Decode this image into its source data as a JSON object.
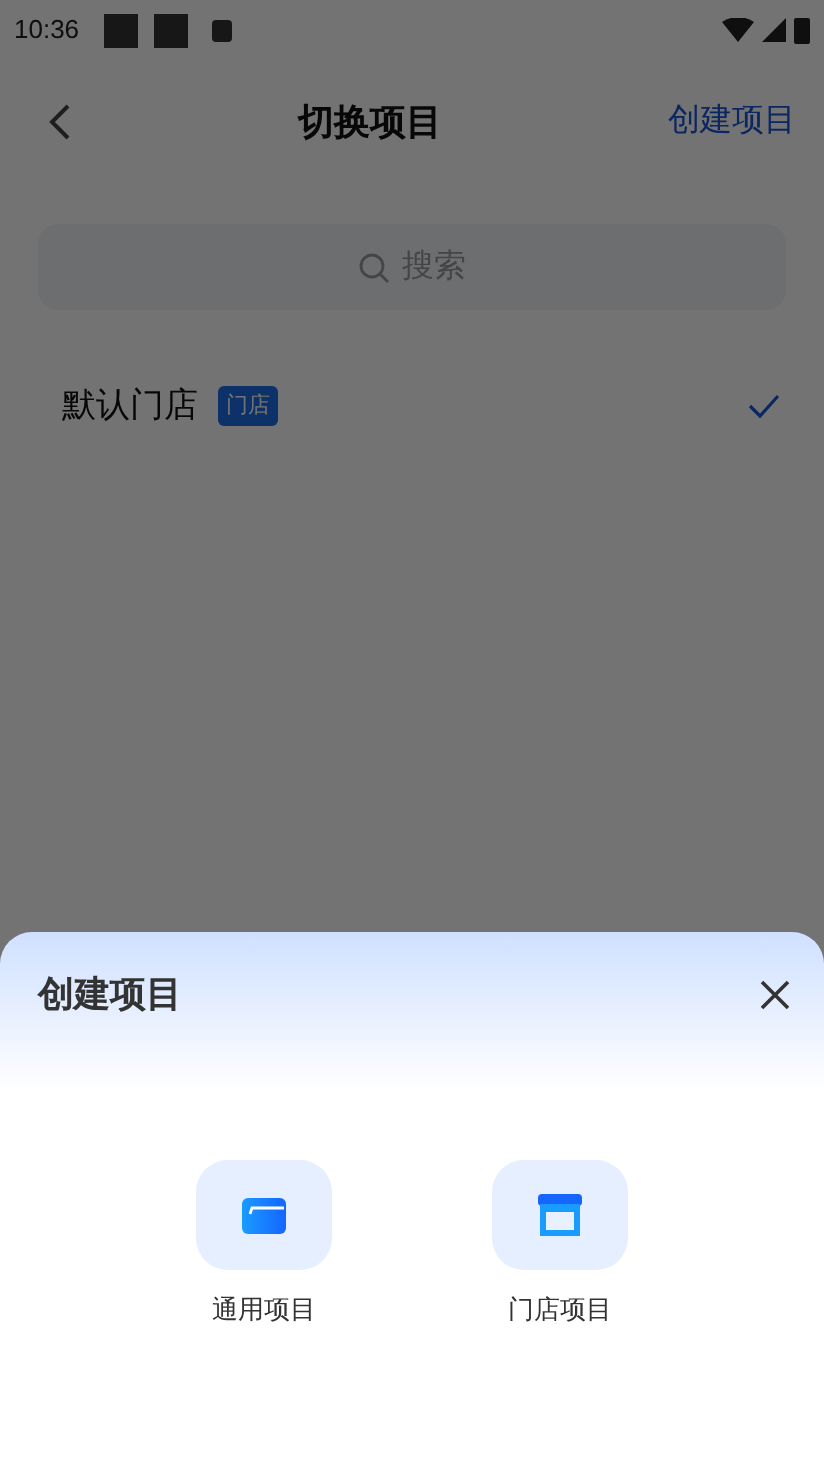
{
  "status_bar": {
    "time": "10:36"
  },
  "header": {
    "title": "切换项目",
    "action": "创建项目"
  },
  "search": {
    "placeholder": "搜索"
  },
  "projects": [
    {
      "name": "默认门店",
      "tag": "门店",
      "selected": true
    }
  ],
  "sheet": {
    "title": "创建项目",
    "options": [
      {
        "kind": "folder",
        "label": "通用项目"
      },
      {
        "kind": "store",
        "label": "门店项目"
      }
    ]
  }
}
